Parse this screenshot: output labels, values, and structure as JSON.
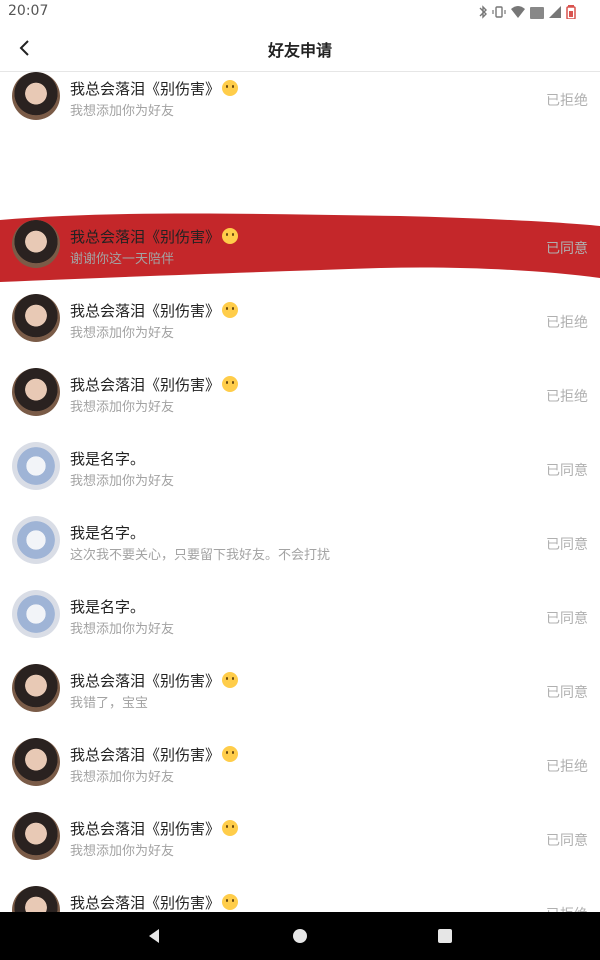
{
  "status_bar": {
    "time": "20:07"
  },
  "header": {
    "title": "好友申请"
  },
  "requests": [
    {
      "name": "我总会落泪《别伤害》",
      "emoji": true,
      "message": "我想添加你为好友",
      "status": "已拒绝",
      "avatar": "a"
    },
    {
      "name": "我总会落泪《别伤害》",
      "emoji": true,
      "message": "谢谢你这一天陪伴",
      "status": "已同意",
      "avatar": "a"
    },
    {
      "name": "我总会落泪《别伤害》",
      "emoji": true,
      "message": "我想添加你为好友",
      "status": "已拒绝",
      "avatar": "a"
    },
    {
      "name": "我总会落泪《别伤害》",
      "emoji": true,
      "message": "我想添加你为好友",
      "status": "已拒绝",
      "avatar": "a"
    },
    {
      "name": "我是名字。",
      "emoji": false,
      "message": "我想添加你为好友",
      "status": "已同意",
      "avatar": "b"
    },
    {
      "name": "我是名字。",
      "emoji": false,
      "message": "这次我不要关心，只要留下我好友。不会打扰",
      "status": "已同意",
      "avatar": "b"
    },
    {
      "name": "我是名字。",
      "emoji": false,
      "message": "我想添加你为好友",
      "status": "已同意",
      "avatar": "b"
    },
    {
      "name": "我总会落泪《别伤害》",
      "emoji": true,
      "message": "我错了，宝宝",
      "status": "已同意",
      "avatar": "a"
    },
    {
      "name": "我总会落泪《别伤害》",
      "emoji": true,
      "message": "我想添加你为好友",
      "status": "已拒绝",
      "avatar": "a"
    },
    {
      "name": "我总会落泪《别伤害》",
      "emoji": true,
      "message": "我想添加你为好友",
      "status": "已同意",
      "avatar": "a"
    },
    {
      "name": "我总会落泪《别伤害》",
      "emoji": true,
      "message": "",
      "status": "已拒绝",
      "avatar": "a"
    }
  ],
  "colors": {
    "redaction": "#c4272a",
    "secondary_text": "#a3a3a3",
    "status_text": "#b0b0b0"
  }
}
